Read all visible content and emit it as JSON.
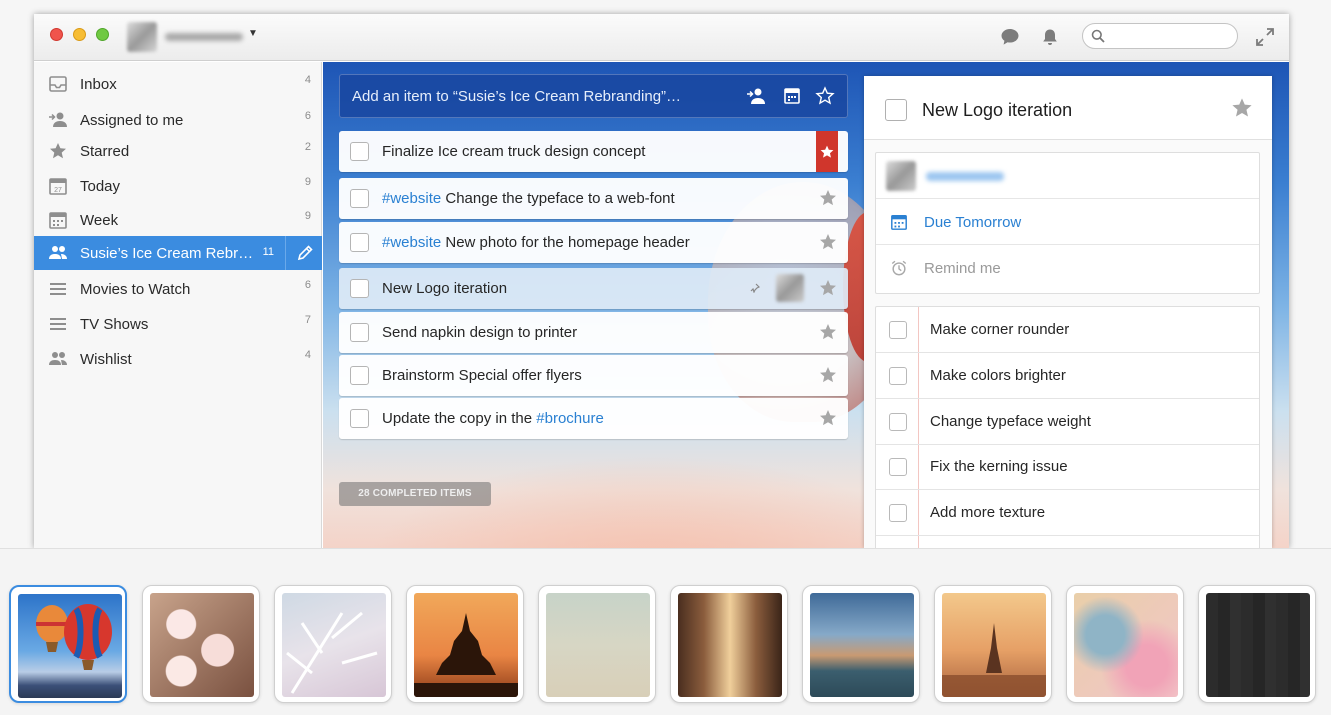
{
  "sidebar": {
    "items": [
      {
        "label": "Inbox",
        "count": "4",
        "icon": "inbox-icon"
      },
      {
        "label": "Assigned to me",
        "count": "6",
        "icon": "assigned-icon"
      },
      {
        "label": "Starred",
        "count": "2",
        "icon": "star-icon"
      },
      {
        "label": "Today",
        "count": "9",
        "icon": "calendar-today-icon"
      },
      {
        "label": "Week",
        "count": "9",
        "icon": "calendar-week-icon"
      },
      {
        "label": "Susie’s Ice Cream Rebr…",
        "count": "11",
        "icon": "shared-list-icon",
        "active": true
      },
      {
        "label": "Movies to Watch",
        "count": "6",
        "icon": "list-icon"
      },
      {
        "label": "TV Shows",
        "count": "7",
        "icon": "list-icon"
      },
      {
        "label": "Wishlist",
        "count": "4",
        "icon": "shared-list-icon"
      }
    ]
  },
  "add_item": {
    "placeholder": "Add an item to “Susie’s Ice Cream Rebranding”…"
  },
  "tasks": [
    {
      "tag": "",
      "title": "Finalize Ice cream truck design concept",
      "starred": true
    },
    {
      "tag": "#website",
      "title": " Change the typeface to a web-font",
      "starred": false
    },
    {
      "tag": "#website",
      "title": " New photo for the homepage header",
      "starred": false
    },
    {
      "tag": "",
      "title": "New Logo iteration",
      "starred": false,
      "selected": true
    },
    {
      "tag": "",
      "title": "Send napkin design to printer",
      "starred": false
    },
    {
      "tag": "",
      "title": "Brainstorm Special offer flyers",
      "starred": false
    },
    {
      "title_prefix": "Update the copy in the ",
      "tag": "#brochure",
      "starred": false
    }
  ],
  "completed_label": "28 COMPLETED ITEMS",
  "detail": {
    "title": "New Logo iteration",
    "due": "Due Tomorrow",
    "remind": "Remind me",
    "subtasks": [
      "Make corner rounder",
      "Make colors brighter",
      "Change typeface weight",
      "Fix the kerning issue",
      "Add more texture"
    ]
  },
  "colors": {
    "accent": "#3b8ce0",
    "star_red": "#d0362c",
    "tag_blue": "#2a80d2"
  },
  "backgrounds": [
    "hot-air-balloons",
    "cherry-blossom",
    "frosted-branches",
    "pagoda-sunset",
    "sand-blur",
    "city-street",
    "canal-city",
    "paris-sunset",
    "pink-flowers",
    "dark-wood"
  ]
}
